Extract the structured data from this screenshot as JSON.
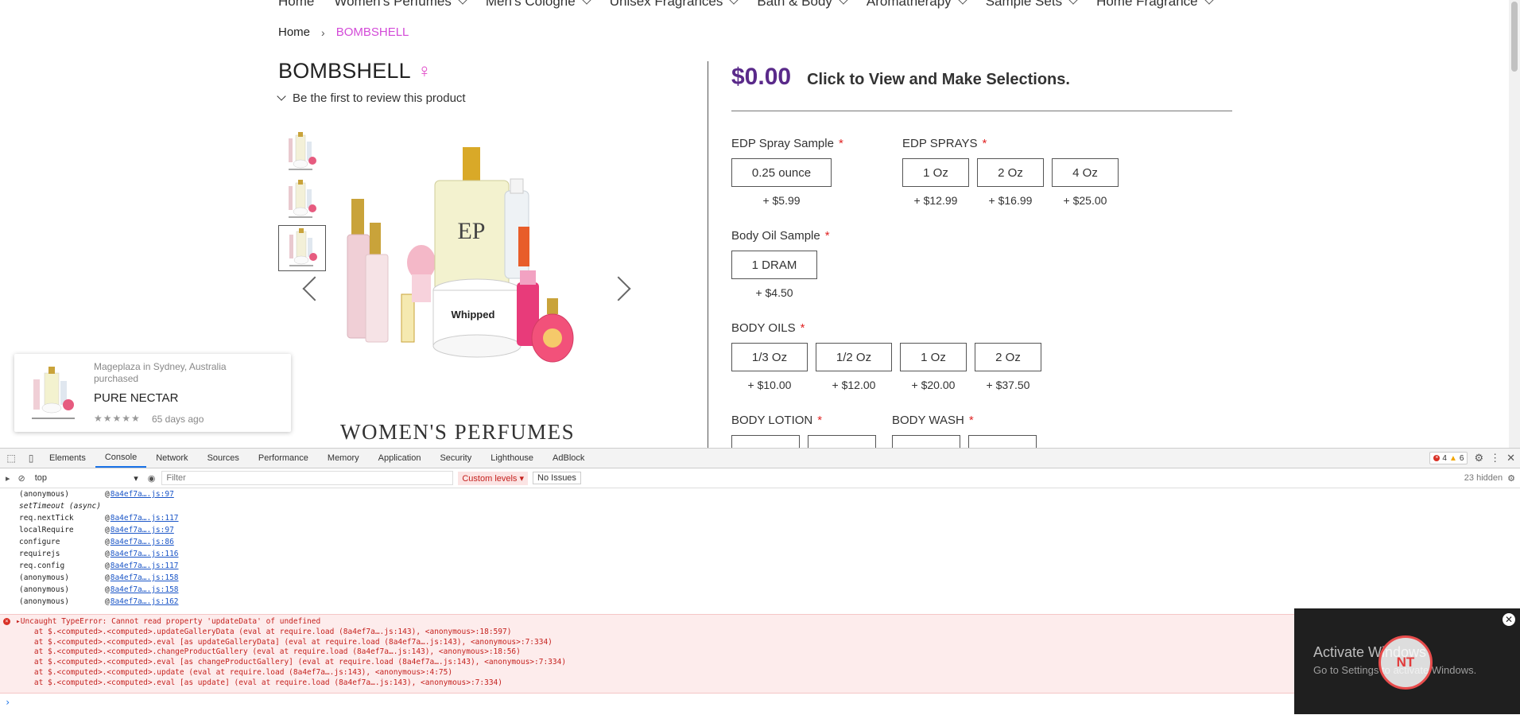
{
  "nav": {
    "items": [
      "Home",
      "Women's Perfumes",
      "Men's Cologne",
      "Unisex Fragrances",
      "Bath & Body",
      "Aromatherapy",
      "Sample Sets",
      "Home Fragrance"
    ]
  },
  "breadcrumb": {
    "home": "Home",
    "sep": "›",
    "current": "BOMBSHELL"
  },
  "product": {
    "title": "BOMBSHELL",
    "gender_symbol": "♀",
    "review_link": "Be the first to review this product",
    "brand_caption": "WOMEN'S PERFUMES",
    "image_main_label": "EP",
    "price": "$0.00",
    "price_note": "Click to View and Make Selections."
  },
  "options": [
    {
      "label": "EDP Spray Sample",
      "required": "*",
      "choices": [
        {
          "name": "0.25 ounce",
          "add": "+ $5.99"
        }
      ]
    },
    {
      "label": "EDP SPRAYS",
      "required": "*",
      "choices": [
        {
          "name": "1 Oz",
          "add": "+ $12.99"
        },
        {
          "name": "2 Oz",
          "add": "+ $16.99"
        },
        {
          "name": "4 Oz",
          "add": "+ $25.00"
        }
      ]
    },
    {
      "label": "Body Oil Sample",
      "required": "*",
      "choices": [
        {
          "name": "1 DRAM",
          "add": "+ $4.50"
        }
      ]
    },
    {
      "label": "BODY OILS",
      "required": "*",
      "choices": [
        {
          "name": "1/3 Oz",
          "add": "+ $10.00"
        },
        {
          "name": "1/2 Oz",
          "add": "+ $12.00"
        },
        {
          "name": "1 Oz",
          "add": "+ $20.00"
        },
        {
          "name": "2 Oz",
          "add": "+ $37.50"
        }
      ]
    },
    {
      "label": "BODY LOTION",
      "required": "*"
    },
    {
      "label": "BODY WASH",
      "required": "*"
    }
  ],
  "popup": {
    "where": "Mageplaza in Sydney, Australia purchased",
    "product": "PURE NECTAR",
    "stars": "★★★★★",
    "ago": "65 days ago"
  },
  "devtools": {
    "tabs": [
      "Elements",
      "Console",
      "Network",
      "Sources",
      "Performance",
      "Memory",
      "Application",
      "Security",
      "Lighthouse",
      "AdBlock"
    ],
    "active_tab": "Console",
    "error_count": "4",
    "warning_count": "6",
    "context": "top",
    "filter_placeholder": "Filter",
    "levels": "Custom levels ▾",
    "issues": "No Issues",
    "hidden": "23 hidden",
    "stack": [
      {
        "fn": "(anonymous)",
        "link": "8a4ef7a….js:97"
      },
      {
        "async": "setTimeout (async)"
      },
      {
        "fn": "req.nextTick",
        "link": "8a4ef7a….js:117"
      },
      {
        "fn": "localRequire",
        "link": "8a4ef7a….js:97"
      },
      {
        "fn": "configure",
        "link": "8a4ef7a….js:86"
      },
      {
        "fn": "requirejs",
        "link": "8a4ef7a….js:116"
      },
      {
        "fn": "req.config",
        "link": "8a4ef7a….js:117"
      },
      {
        "fn": "(anonymous)",
        "link": "8a4ef7a….js:158"
      },
      {
        "fn": "(anonymous)",
        "link": "8a4ef7a….js:158"
      },
      {
        "fn": "(anonymous)",
        "link": "8a4ef7a….js:162"
      }
    ],
    "error_lines": [
      "▸Uncaught TypeError: Cannot read property 'updateData' of undefined",
      "    at $.<computed>.<computed>.updateGalleryData (eval at require.load (8a4ef7a….js:143), <anonymous>:18:597)",
      "    at $.<computed>.<computed>.eval [as updateGalleryData] (eval at require.load (8a4ef7a….js:143), <anonymous>:7:334)",
      "    at $.<computed>.<computed>.changeProductGallery (eval at require.load (8a4ef7a….js:143), <anonymous>:18:56)",
      "    at $.<computed>.<computed>.eval [as changeProductGallery] (eval at require.load (8a4ef7a….js:143), <anonymous>:7:334)",
      "    at $.<computed>.<computed>.update (eval at require.load (8a4ef7a….js:143), <anonymous>:4:75)",
      "    at $.<computed>.<computed>.eval [as update] (eval at require.load (8a4ef7a….js:143), <anonymous>:7:334)"
    ],
    "prompt": "›"
  },
  "overlay": {
    "close": "✕",
    "activate_title": "Activate Windows",
    "activate_sub": "Go to Settings to activate Windows.",
    "nt_logo": "NT"
  }
}
